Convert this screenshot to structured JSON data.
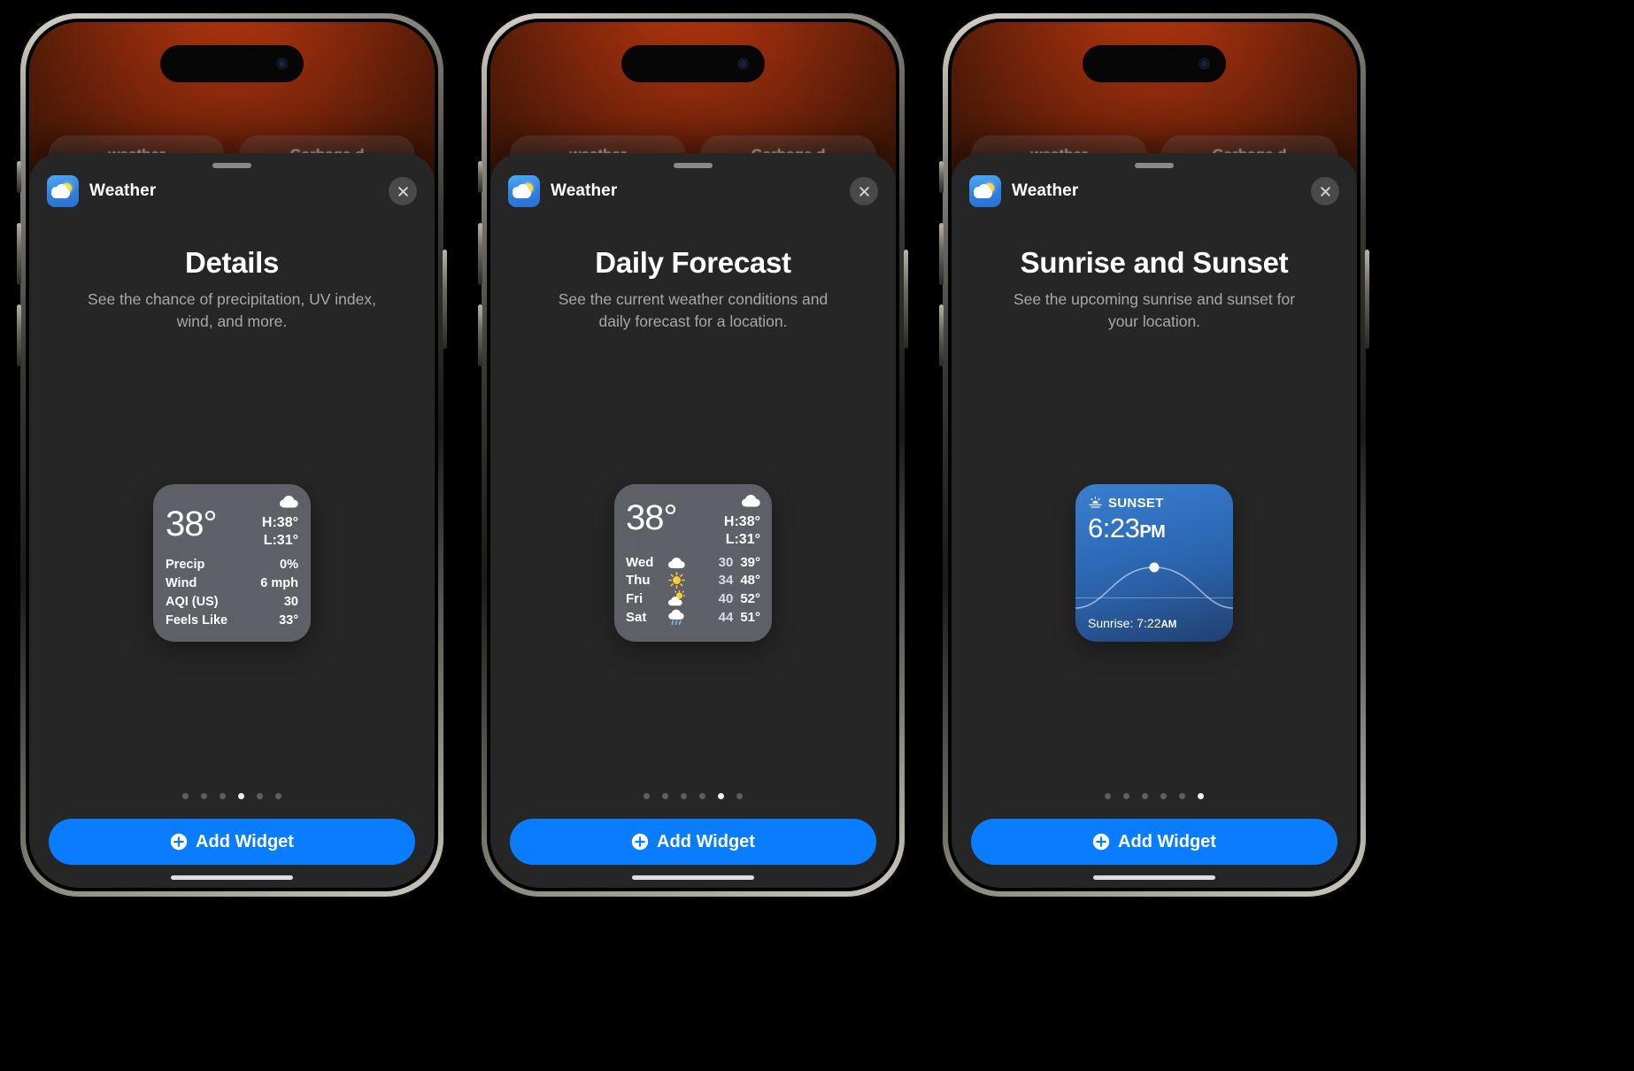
{
  "app": {
    "name": "Weather",
    "icon": "weather-app-icon"
  },
  "phones": [
    {
      "id": "phone-details",
      "sheet": {
        "title": "Details",
        "subtitle": "See the chance of precipitation, UV index, wind, and more.",
        "close_label": "Close",
        "add_button": "Add Widget",
        "dots_total": 6,
        "dots_active": 4
      },
      "widget": {
        "kind": "details",
        "temp": "38°",
        "high": "H:38°",
        "low": "L:31°",
        "condition_icon": "cloud-icon",
        "rows": [
          {
            "label": "Precip",
            "value": "0%"
          },
          {
            "label": "Wind",
            "value": "6 mph"
          },
          {
            "label": "AQI (US)",
            "value": "30"
          },
          {
            "label": "Feels Like",
            "value": "33°"
          }
        ]
      }
    },
    {
      "id": "phone-daily-forecast",
      "sheet": {
        "title": "Daily Forecast",
        "subtitle": "See the current weather conditions and daily forecast for a location.",
        "close_label": "Close",
        "add_button": "Add Widget",
        "dots_total": 6,
        "dots_active": 5
      },
      "widget": {
        "kind": "daily-forecast",
        "temp": "38°",
        "high": "H:38°",
        "low": "L:31°",
        "condition_icon": "cloud-icon",
        "days": [
          {
            "day": "Wed",
            "icon": "cloud-icon",
            "lo": "30",
            "hi": "39°"
          },
          {
            "day": "Thu",
            "icon": "sun-icon",
            "lo": "34",
            "hi": "48°"
          },
          {
            "day": "Fri",
            "icon": "sun-cloud-icon",
            "lo": "40",
            "hi": "52°"
          },
          {
            "day": "Sat",
            "icon": "rain-cloud-icon",
            "lo": "44",
            "hi": "51°"
          }
        ]
      }
    },
    {
      "id": "phone-sunrise-sunset",
      "sheet": {
        "title": "Sunrise and Sunset",
        "subtitle": "See the upcoming sunrise and sunset for your location.",
        "close_label": "Close",
        "add_button": "Add Widget",
        "dots_total": 6,
        "dots_active": 6
      },
      "widget": {
        "kind": "sunset",
        "label": "SUNSET",
        "label_icon": "sunset-icon",
        "time": "6:23",
        "time_period": "PM",
        "footer_prefix": "Sunrise: 7:22",
        "footer_period": "AM"
      }
    }
  ],
  "ghost_cards": [
    "weather",
    "Garbage d"
  ],
  "colors": {
    "accent_blue": "#0a7cff",
    "sheet_bg": "#262626",
    "widget_glass": "rgba(140,146,156,0.55)",
    "sunset_blue": "#2e6cbb",
    "subtitle_grey": "#a8a8a8",
    "dot_inactive": "#5e5e5e",
    "dot_active": "#efefef"
  }
}
